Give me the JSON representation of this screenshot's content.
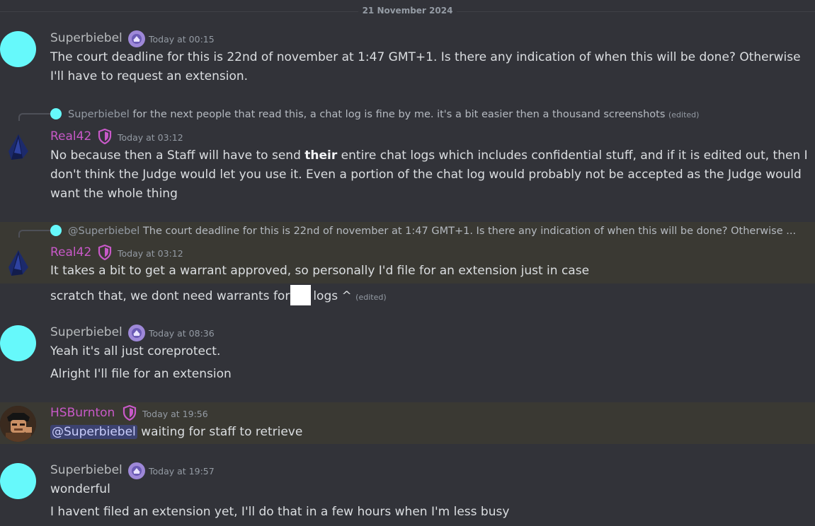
{
  "date_divider": "21 November 2024",
  "colors": {
    "background": "#323339",
    "highlight": "#3a3933",
    "superbiebel_avatar": "#66f9fb",
    "role_purple": "#c859c8",
    "mention_bg": "#3c4270"
  },
  "messages": [
    {
      "author": "Superbiebel",
      "badge_icon": "server-boost-icon",
      "time": "Today at 00:15",
      "lines": [
        "The court deadline for this is 22nd of november at 1:47 GMT+1. Is there any indication of when this will be done?  Otherwise",
        "I'll have to request an extension."
      ]
    },
    {
      "reply": {
        "author": "Superbiebel",
        "text": "for the next people that read this, a chat log is fine by me. it's a bit easier then a thousand screenshots",
        "edited": "(edited)"
      },
      "author": "Real42",
      "badge_icon": "shield-icon",
      "time": "Today at 03:12",
      "lines": [
        {
          "before": "No because then a Staff will have to send ",
          "bold": "their",
          "after": " entire chat logs which includes confidential stuff, and if it is edited out, then I"
        },
        "don't think the Judge would let you use it. Even a portion of the chat log would probably not be accepted as the Judge would",
        "want the whole thing"
      ]
    },
    {
      "reply": {
        "author": "@Superbiebel",
        "text": "The court deadline for this is 22nd of november at 1:47 GMT+1. Is there any indication of when this will be done?  Otherwise ..."
      },
      "author": "Real42",
      "badge_icon": "shield-icon",
      "time": "Today at 03:12",
      "lines": [
        "It takes a bit to get a warrant approved, so personally I'd file for an extension just in case"
      ],
      "followups": [
        {
          "before": "scratch that, we dont need warrants for",
          "after": "logs ^",
          "edited": "(edited)"
        }
      ]
    },
    {
      "author": "Superbiebel",
      "badge_icon": "server-boost-icon",
      "time": "Today at 08:36",
      "lines": [
        "Yeah it's all just coreprotect."
      ],
      "followups": [
        "Alright I'll file for an extension"
      ]
    },
    {
      "author": "HSBurnton",
      "badge_icon": "shield-icon",
      "time": "Today at 19:56",
      "mention": "@Superbiebel",
      "lines": [
        "waiting for staff to retrieve"
      ]
    },
    {
      "author": "Superbiebel",
      "badge_icon": "server-boost-icon",
      "time": "Today at 19:57",
      "lines": [
        "wonderful"
      ],
      "followups": [
        "I havent filed an extension yet, I'll do that in a few hours when I'm less busy"
      ]
    }
  ]
}
